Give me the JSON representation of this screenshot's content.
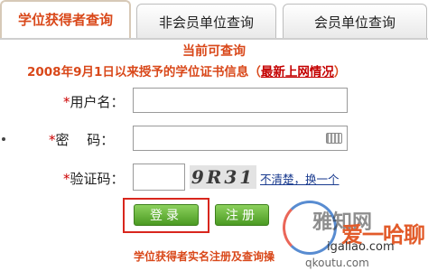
{
  "tabs": [
    {
      "label": "学位获得者查询",
      "active": true
    },
    {
      "label": "非会员单位查询",
      "active": false
    },
    {
      "label": "会员单位查询",
      "active": false
    }
  ],
  "notice": {
    "line1": "当前可查询",
    "line2_text": "2008年9月1日以来授予的学位证书信息（",
    "line2_link": "最新上网情况",
    "line2_end": "）"
  },
  "form": {
    "required_mark": "*",
    "username_label": "用户名：",
    "username_value": "",
    "password_label": "密　 码：",
    "password_value": "",
    "captcha_label": "验证码：",
    "captcha_value": "",
    "captcha_image_text": "9R31",
    "captcha_refresh": "不清楚，换一个"
  },
  "buttons": {
    "login": "登录",
    "register": "注册"
  },
  "footer": {
    "note": "学位获得者实名注册及查询操"
  },
  "watermark": {
    "brand": "雅知网",
    "cn_text": "爱一哈聊",
    "url": "igaliao.com",
    "url2": "qkoutu.com"
  },
  "colors": {
    "accent": "#d9481a",
    "link": "#c40000",
    "button_green": "#4a9a22",
    "highlight_red": "#d8261d"
  }
}
